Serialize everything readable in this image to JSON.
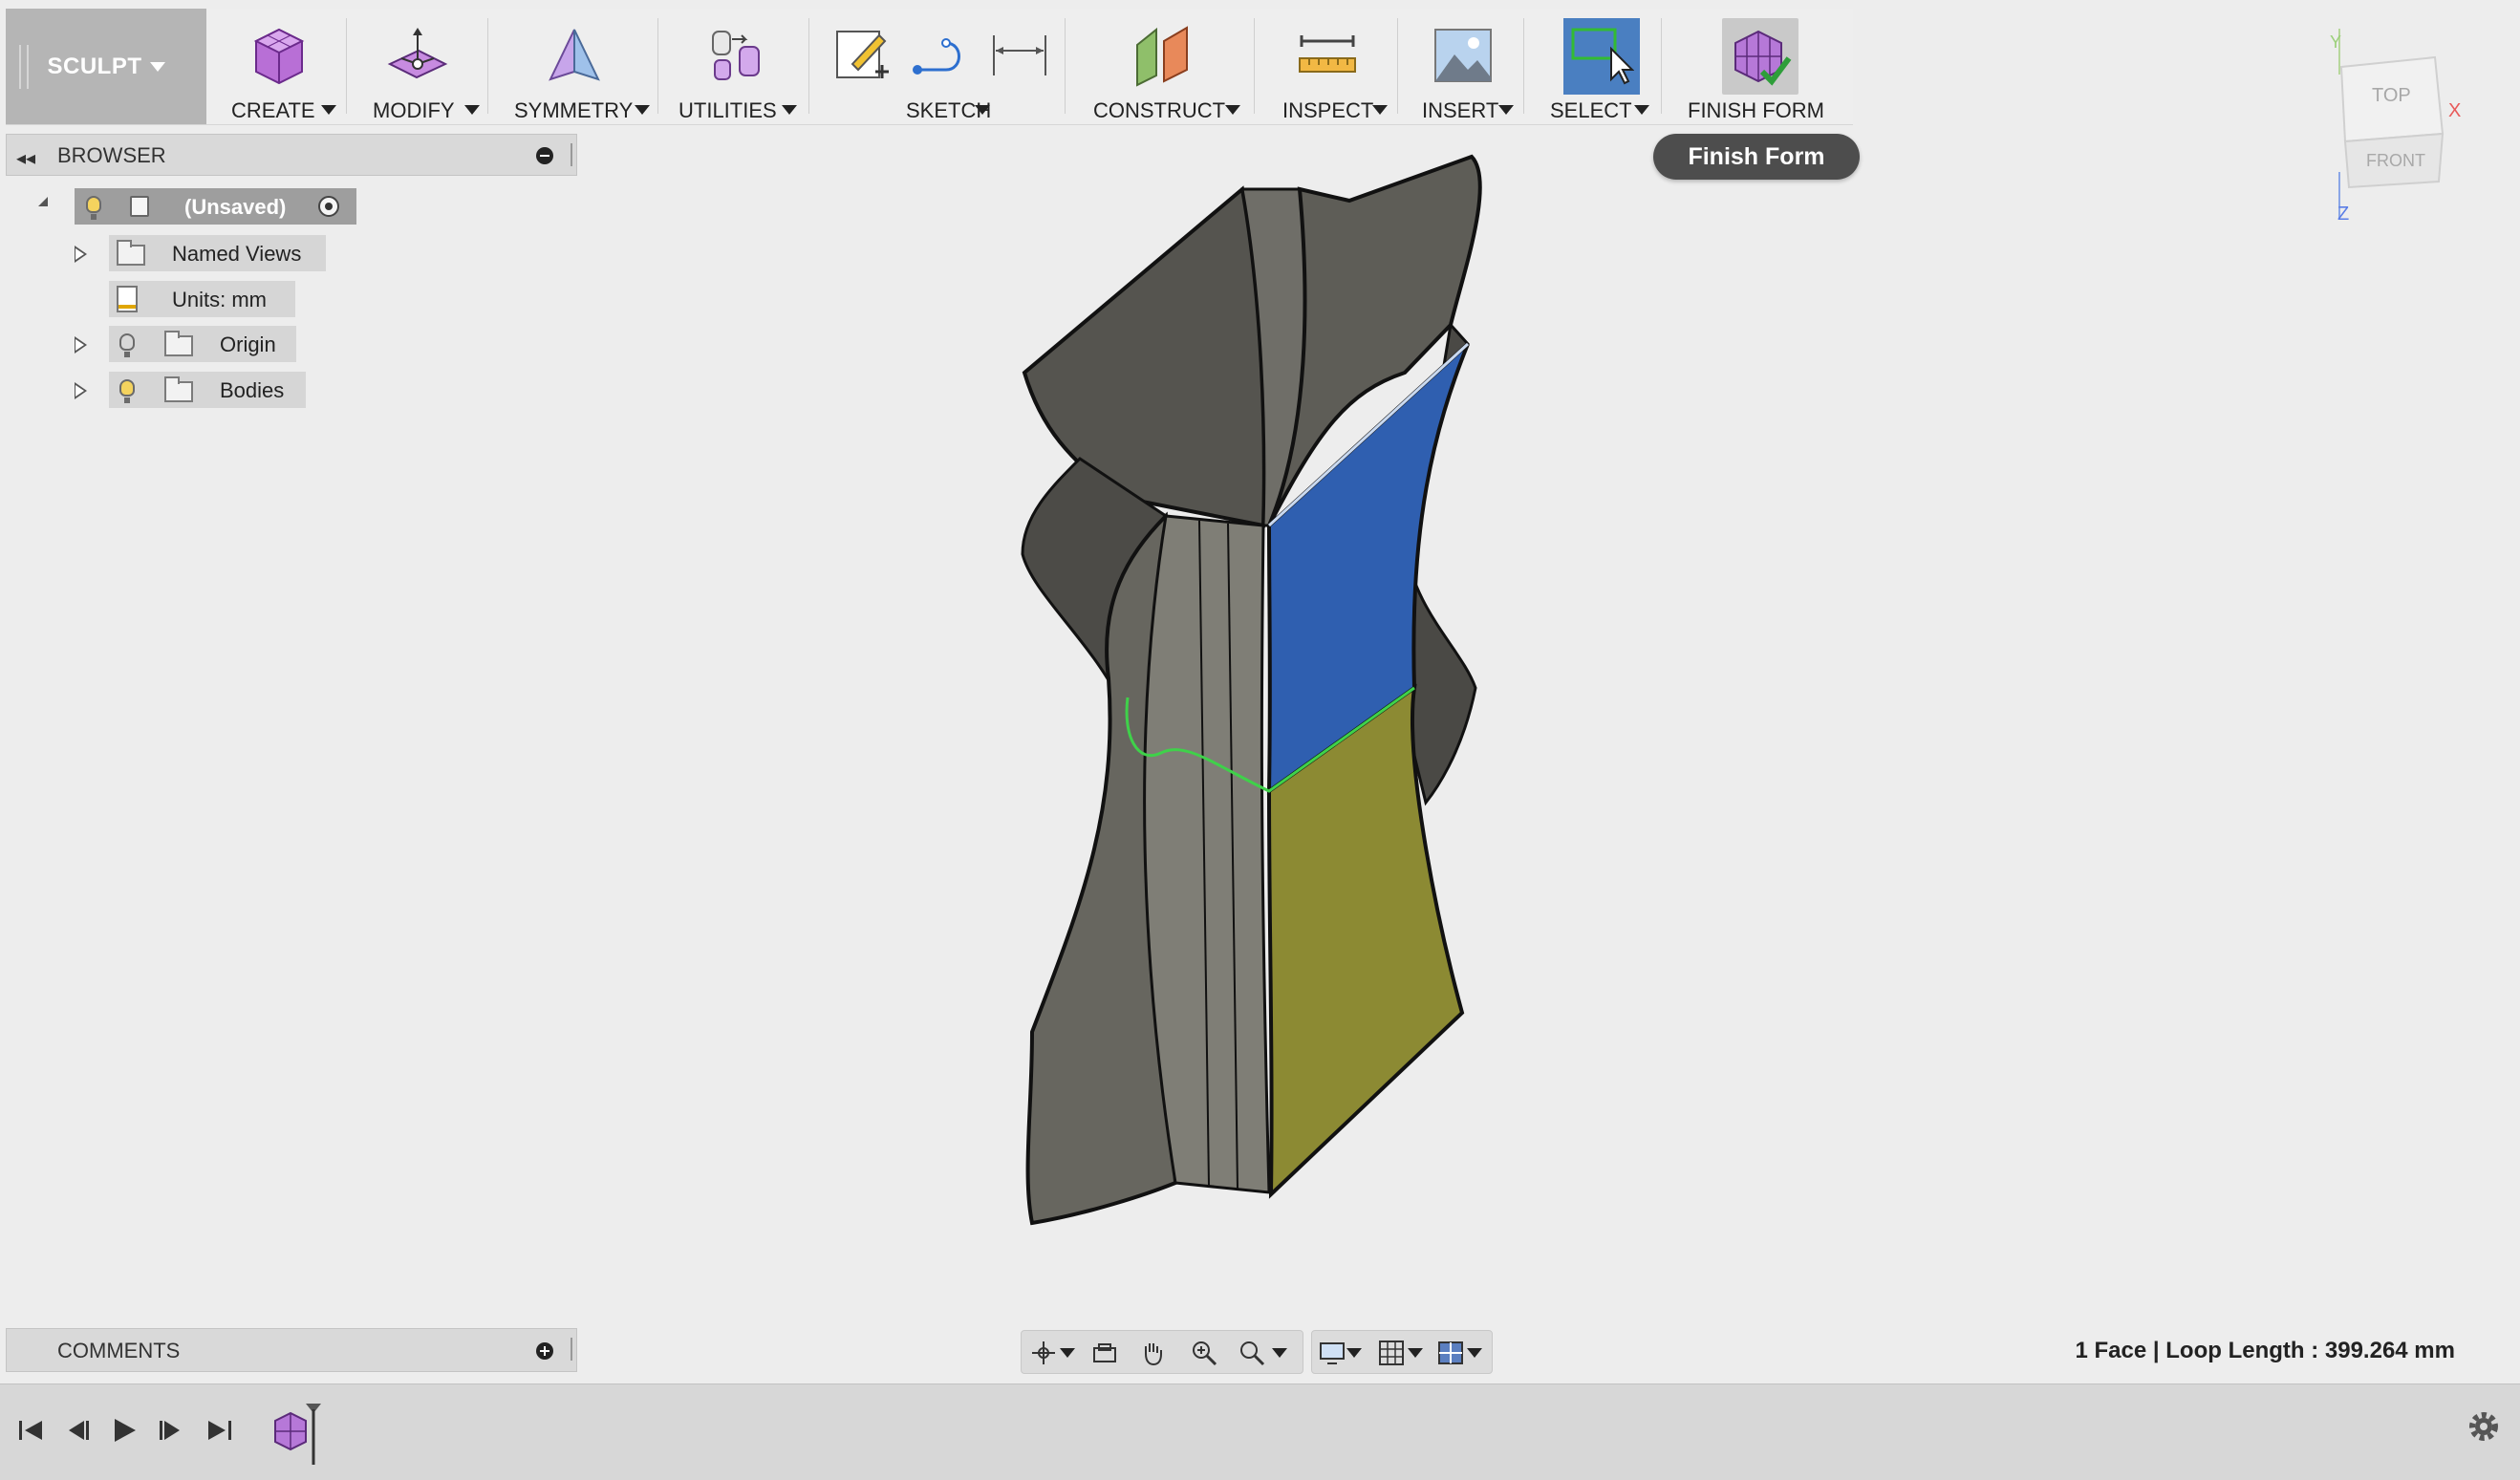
{
  "toolbar": {
    "workspace_label": "SCULPT",
    "groups": [
      {
        "label": "CREATE",
        "icon": "create-box-icon"
      },
      {
        "label": "MODIFY",
        "icon": "modify-icon"
      },
      {
        "label": "SYMMETRY",
        "icon": "symmetry-icon"
      },
      {
        "label": "UTILITIES",
        "icon": "utilities-icon"
      },
      {
        "label": "SKETCH",
        "icon": "sketch-icon"
      },
      {
        "label": "CONSTRUCT",
        "icon": "construct-icon"
      },
      {
        "label": "INSPECT",
        "icon": "inspect-ruler-icon"
      },
      {
        "label": "INSERT",
        "icon": "insert-image-icon"
      },
      {
        "label": "SELECT",
        "icon": "select-icon"
      },
      {
        "label": "FINISH FORM",
        "icon": "finish-form-icon"
      }
    ]
  },
  "tooltip": {
    "text": "Finish Form"
  },
  "browser": {
    "title": "BROWSER",
    "root": {
      "label": "(Unsaved)"
    },
    "items": [
      {
        "label": "Named Views"
      },
      {
        "label": "Units: mm"
      },
      {
        "label": "Origin"
      },
      {
        "label": "Bodies"
      }
    ]
  },
  "comments": {
    "title": "COMMENTS"
  },
  "viewcube": {
    "top": "TOP",
    "front": "FRONT",
    "axis_x": "X",
    "axis_y": "Y",
    "axis_z": "Z"
  },
  "status": {
    "text": "1 Face | Loop Length : 399.264 mm"
  },
  "colors": {
    "selected_face": "#2f5fb0",
    "highlight_face": "#8c8a33",
    "body": "#5b5a55",
    "select_button": "#4a7fc1",
    "edge_highlight": "#3fd14a"
  }
}
